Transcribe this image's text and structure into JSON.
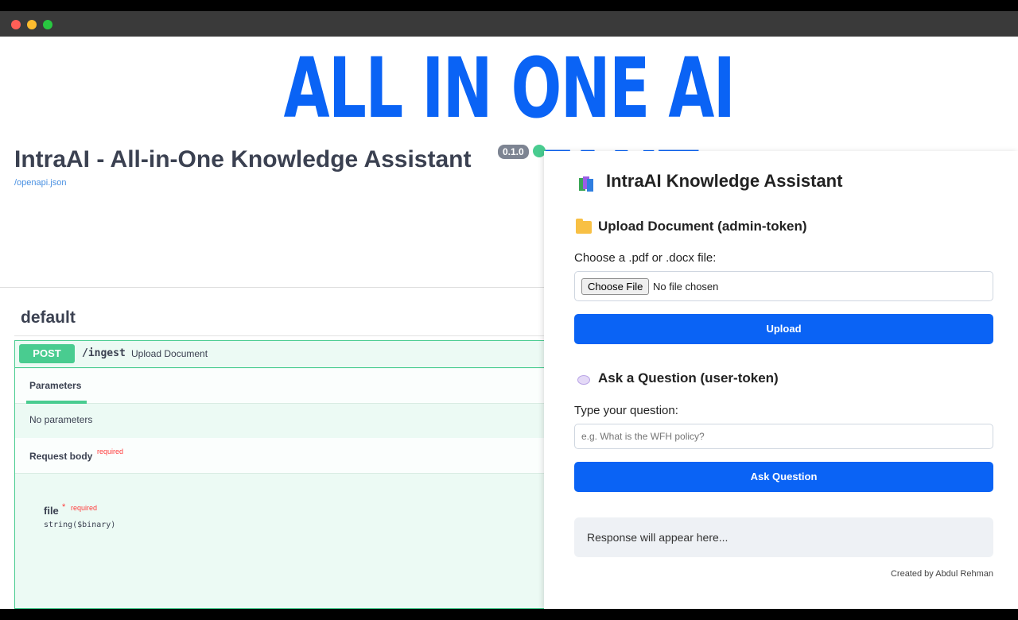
{
  "window": {
    "traffic_lights": [
      "close",
      "minimize",
      "maximize"
    ]
  },
  "banner": {
    "text": "ALL IN ONE AI ASSISITANT",
    "color": "#0a63f5"
  },
  "swagger": {
    "title": "IntraAI - All-in-One Knowledge Assistant",
    "version": "0.1.0",
    "spec_link": "/openapi.json",
    "section": "default",
    "operation": {
      "method": "POST",
      "path": "/ingest",
      "summary": "Upload Document",
      "tab": "Parameters",
      "no_params": "No parameters",
      "request_body": "Request body",
      "required": "required",
      "field_name": "file",
      "field_star": "*",
      "field_required": "required",
      "field_type": "string($binary)"
    }
  },
  "assistant": {
    "title": "IntraAI Knowledge Assistant",
    "title_icon": "books-icon",
    "upload_section": "Upload Document (admin-token)",
    "upload_section_icon": "folder-icon",
    "file_label": "Choose a .pdf or .docx file:",
    "file_button": "Choose File",
    "file_status": "No file chosen",
    "upload_button": "Upload",
    "question_section": "Ask a Question (user-token)",
    "question_section_icon": "speech-bubble-icon",
    "question_label": "Type your question:",
    "question_placeholder": "e.g. What is the WFH policy?",
    "ask_button": "Ask Question",
    "response_placeholder": "Response will appear here...",
    "credit": "Created by Abdul Rehman",
    "accent_color": "#0a63f5"
  }
}
